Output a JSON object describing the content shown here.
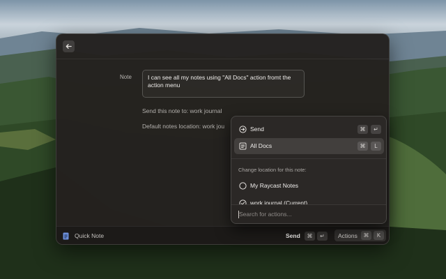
{
  "window": {
    "back_icon": "arrow-left-icon",
    "form": {
      "note_label": "Note",
      "note_value": "I can see all my notes using \"All Docs\" action fromt the action menu",
      "send_info": "Send this note to: work journal",
      "default_location": "Default notes location: work jou"
    },
    "bottom_bar": {
      "app_icon": "document-icon",
      "app_name": "Quick Note",
      "primary_action": "Send",
      "primary_keys": [
        "⌘",
        "↵"
      ],
      "actions_label": "Actions",
      "actions_keys": [
        "⌘",
        "K"
      ]
    }
  },
  "action_panel": {
    "items": [
      {
        "label": "Send",
        "icon": "arrow-right-circle-icon",
        "keys": [
          "⌘",
          "↵"
        ],
        "selected": false
      },
      {
        "label": "All Docs",
        "icon": "document-list-icon",
        "keys": [
          "⌘",
          "L"
        ],
        "selected": true
      }
    ],
    "section_title": "Change location for this note:",
    "locations": [
      {
        "label": "My Raycast Notes",
        "icon": "circle-icon",
        "current": false
      },
      {
        "label": "work journal (Current)",
        "icon": "check-circle-icon",
        "current": true
      }
    ],
    "search_placeholder": "Search for actions..."
  },
  "colors": {
    "window_bg": "#24211f",
    "panel_bg": "#2c2826",
    "text_primary": "#efedeb",
    "text_secondary": "#b3b0ad",
    "app_icon_color": "#6d8fd8"
  }
}
